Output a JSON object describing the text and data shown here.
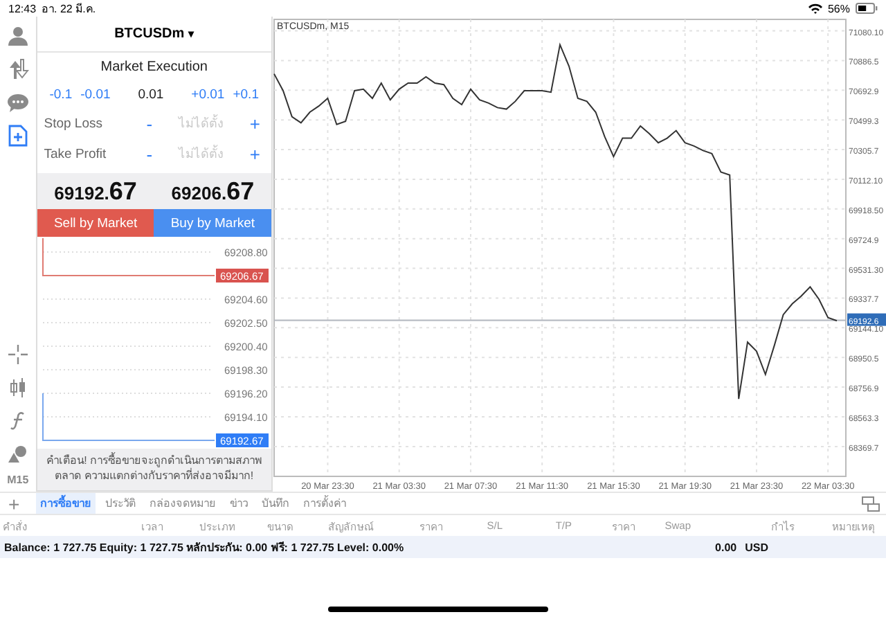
{
  "status_bar": {
    "time": "12:43",
    "date": "อา. 22 มี.ค.",
    "battery": "56%"
  },
  "toolbar": {
    "tools": [
      {
        "kind": "account",
        "selected": false
      },
      {
        "kind": "trade-arrows",
        "selected": false
      },
      {
        "kind": "chat",
        "selected": false
      },
      {
        "kind": "new-order",
        "selected": true
      }
    ],
    "chart_tools": [
      {
        "kind": "crosshair"
      },
      {
        "kind": "candles"
      },
      {
        "kind": "function"
      },
      {
        "kind": "objects"
      }
    ],
    "timeframe": "M15",
    "add": "+"
  },
  "order": {
    "symbol": "BTCUSDm",
    "caret": "▾",
    "mode": "Market Execution",
    "volume_down": [
      "-0.1",
      "-0.01"
    ],
    "volume": "0.01",
    "volume_up": [
      "+0.01",
      "+0.1"
    ],
    "levels": [
      {
        "label": "Stop Loss",
        "minus": "-",
        "value": "ไม่ได้ตั้ง",
        "plus": "+"
      },
      {
        "label": "Take Profit",
        "minus": "-",
        "value": "ไม่ได้ตั้ง",
        "plus": "+"
      }
    ],
    "bid": {
      "main": "69192.",
      "big": "67"
    },
    "ask": {
      "main": "69206.",
      "big": "67"
    },
    "sell_button": "Sell by Market",
    "buy_button": "Buy by Market",
    "tick_rows": [
      {
        "label": "69208.80",
        "kind": "level"
      },
      {
        "label": "69206.67",
        "kind": "ask"
      },
      {
        "label": "69204.60",
        "kind": "level"
      },
      {
        "label": "69202.50",
        "kind": "level"
      },
      {
        "label": "69200.40",
        "kind": "level"
      },
      {
        "label": "69198.30",
        "kind": "level"
      },
      {
        "label": "69196.20",
        "kind": "level"
      },
      {
        "label": "69194.10",
        "kind": "level"
      },
      {
        "label": "69192.67",
        "kind": "bid"
      }
    ],
    "warning": "คำเตือน! การซื้อขายจะถูกดำเนินการตามสภาพตลาด ความแตกต่างกับราคาที่ส่งอาจมีมาก!"
  },
  "chart": {
    "title": "BTCUSDm, M15",
    "chart_data": {
      "type": "line",
      "categories": [
        null,
        null,
        null,
        null,
        null,
        null,
        "20 Mar 23:30",
        null,
        null,
        null,
        null,
        null,
        null,
        null,
        "21 Mar 03:30",
        null,
        null,
        null,
        null,
        null,
        null,
        null,
        "21 Mar 07:30",
        null,
        null,
        null,
        null,
        null,
        null,
        null,
        "21 Mar 11:30",
        null,
        null,
        null,
        null,
        null,
        null,
        null,
        "21 Mar 15:30",
        null,
        null,
        null,
        null,
        null,
        null,
        null,
        "21 Mar 19:30",
        null,
        null,
        null,
        null,
        null,
        null,
        null,
        "21 Mar 23:30",
        null,
        null,
        null,
        null,
        null,
        null,
        null,
        "22 Mar 03:30",
        null
      ],
      "series": [
        {
          "color": "#333333",
          "values": [
            70800,
            70690,
            70520,
            70480,
            70550,
            70590,
            70640,
            70470,
            70490,
            70690,
            70700,
            70640,
            70740,
            70630,
            70700,
            70740,
            70740,
            70780,
            70740,
            70730,
            70640,
            70600,
            70700,
            70630,
            70610,
            70580,
            70570,
            70620,
            70690,
            70690,
            70690,
            70680,
            70990,
            70850,
            70640,
            70620,
            70550,
            70390,
            70260,
            70380,
            70380,
            70460,
            70410,
            70350,
            70380,
            70430,
            70350,
            70330,
            70300,
            70280,
            70160,
            70140,
            68680,
            69050,
            68990,
            68840,
            69030,
            69230,
            69300,
            69350,
            69410,
            69330,
            69210,
            69190
          ]
        }
      ],
      "ylim": [
        68175,
        71155
      ],
      "yticks": [
        {
          "value": 71080.1,
          "label": "71080.10"
        },
        {
          "value": 70886.5,
          "label": "70886.5"
        },
        {
          "value": 70692.9,
          "label": "70692.9"
        },
        {
          "value": 70499.3,
          "label": "70499.3"
        },
        {
          "value": 70305.7,
          "label": "70305.7"
        },
        {
          "value": 70112.1,
          "label": "70112.10"
        },
        {
          "value": 69918.5,
          "label": "69918.50"
        },
        {
          "value": 69724.9,
          "label": "69724.9"
        },
        {
          "value": 69531.3,
          "label": "69531.30"
        },
        {
          "value": 69337.7,
          "label": "69337.7"
        },
        {
          "value": 69144.1,
          "label": "69144.10"
        },
        {
          "value": 68950.5,
          "label": "68950.5"
        },
        {
          "value": 68756.9,
          "label": "68756.9"
        },
        {
          "value": 68563.3,
          "label": "68563.3"
        },
        {
          "value": 68369.7,
          "label": "68369.7"
        }
      ],
      "ref_lines": [
        {
          "axis": "y",
          "value": 69192.6,
          "label": "69192.6"
        }
      ],
      "grid": true
    }
  },
  "tabs": [
    {
      "label": "การซื้อขาย",
      "selected": true
    },
    {
      "label": "ประวัติ",
      "selected": false
    },
    {
      "label": "กล่องจดหมาย",
      "selected": false
    },
    {
      "label": "ข่าว",
      "selected": false
    },
    {
      "label": "บันทึก",
      "selected": false
    },
    {
      "label": "การตั้งค่า",
      "selected": false
    }
  ],
  "table": {
    "columns": [
      "คำสั่ง",
      "เวลา",
      "ประเภท",
      "ขนาด",
      "สัญลักษณ์",
      "ราคา",
      "S/L",
      "T/P",
      "ราคา",
      "Swap",
      "กำไร",
      "หมายเหตุ"
    ]
  },
  "balance": {
    "summary": "Balance: 1 727.75 Equity: 1 727.75 หลักประกัน: 0.00 ฟรี: 1 727.75 Level: 0.00%",
    "profit": "0.00",
    "currency": "USD"
  }
}
